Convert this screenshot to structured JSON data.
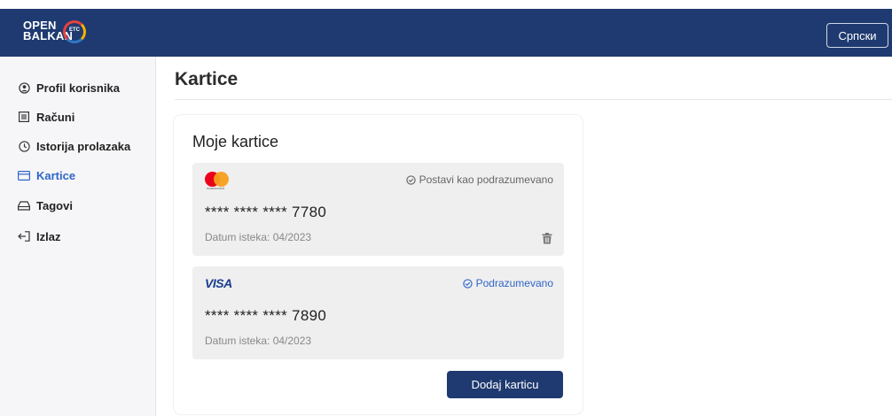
{
  "header": {
    "logo_line1": "OPEN",
    "logo_line2": "BALKAN",
    "logo_badge": "ETC",
    "language_button": "Српски",
    "bg_color": "#1f3a70"
  },
  "sidebar": {
    "items": [
      {
        "label": "Profil korisnika",
        "icon": "user-circle-icon",
        "active": false
      },
      {
        "label": "Računi",
        "icon": "receipt-icon",
        "active": false
      },
      {
        "label": "Istorija prolazaka",
        "icon": "clock-icon",
        "active": false
      },
      {
        "label": "Kartice",
        "icon": "credit-card-icon",
        "active": true
      },
      {
        "label": "Tagovi",
        "icon": "tag-device-icon",
        "active": false
      },
      {
        "label": "Izlaz",
        "icon": "logout-icon",
        "active": false
      }
    ],
    "active_color": "#2f65c8"
  },
  "main": {
    "title": "Kartice",
    "panel_title": "Moje kartice",
    "cards": [
      {
        "brand": "mastercard",
        "brand_small_text": "mastercard",
        "number": "**** **** **** 7780",
        "expiry": "Datum isteka: 04/2023",
        "action": "Postavi kao podrazumevano",
        "is_default": false,
        "deletable": true
      },
      {
        "brand": "visa",
        "brand_text": "VISA",
        "number": "**** **** **** 7890",
        "expiry": "Datum isteka: 04/2023",
        "action": "Podrazumevano",
        "is_default": true,
        "deletable": false
      }
    ],
    "add_button": "Dodaj karticu"
  }
}
